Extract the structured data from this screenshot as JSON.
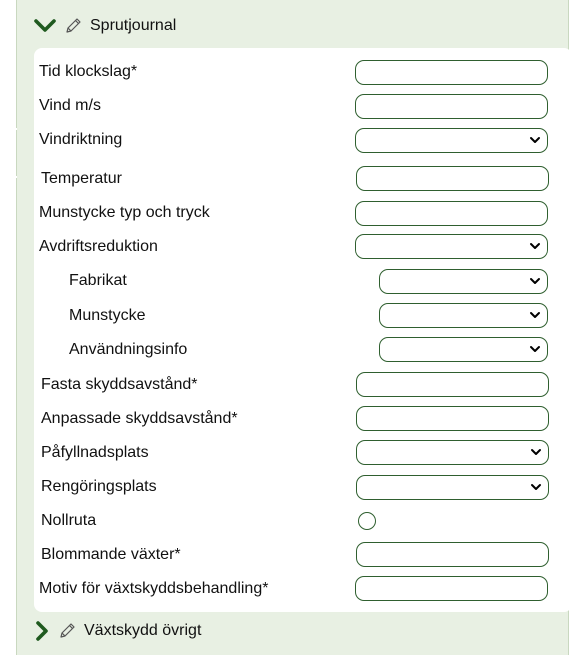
{
  "sprutjournal": {
    "title": "Sprutjournal",
    "expanded": true,
    "fields": [
      {
        "label": "Tid klockslag*",
        "type": "text",
        "value": ""
      },
      {
        "label": "Vind m/s",
        "type": "text",
        "value": ""
      },
      {
        "label": "Vindriktning",
        "type": "select",
        "value": ""
      },
      {
        "label": "Temperatur",
        "type": "text",
        "value": ""
      },
      {
        "label": "Munstycke typ och tryck",
        "type": "text",
        "value": ""
      },
      {
        "label": "Avdriftsreduktion",
        "type": "select",
        "value": ""
      },
      {
        "label": "Fabrikat",
        "type": "select",
        "value": "",
        "indent": true
      },
      {
        "label": "Munstycke",
        "type": "select",
        "value": "",
        "indent": true
      },
      {
        "label": "Användningsinfo",
        "type": "select",
        "value": "",
        "indent": true
      },
      {
        "label": "Fasta skyddsavstånd*",
        "type": "text",
        "value": ""
      },
      {
        "label": "Anpassade skyddsavstånd*",
        "type": "text",
        "value": ""
      },
      {
        "label": "Påfyllnadsplats",
        "type": "select",
        "value": ""
      },
      {
        "label": "Rengöringsplats",
        "type": "select",
        "value": ""
      },
      {
        "label": "Nollruta",
        "type": "radio",
        "checked": false
      },
      {
        "label": "Blommande växter*",
        "type": "text",
        "value": ""
      },
      {
        "label": "Motiv för växtskyddsbehandling*",
        "type": "text",
        "value": ""
      }
    ]
  },
  "vaxtskydd_ovrigt": {
    "title": "Växtskydd övrigt",
    "expanded": false
  },
  "colors": {
    "accent": "#1f5a1f",
    "panel_bg": "#e8f0e3",
    "field_border": "#2f5f2f"
  },
  "icons": {
    "expand": "chevron-down-icon",
    "collapse": "chevron-right-icon",
    "edit": "pencil-icon"
  }
}
